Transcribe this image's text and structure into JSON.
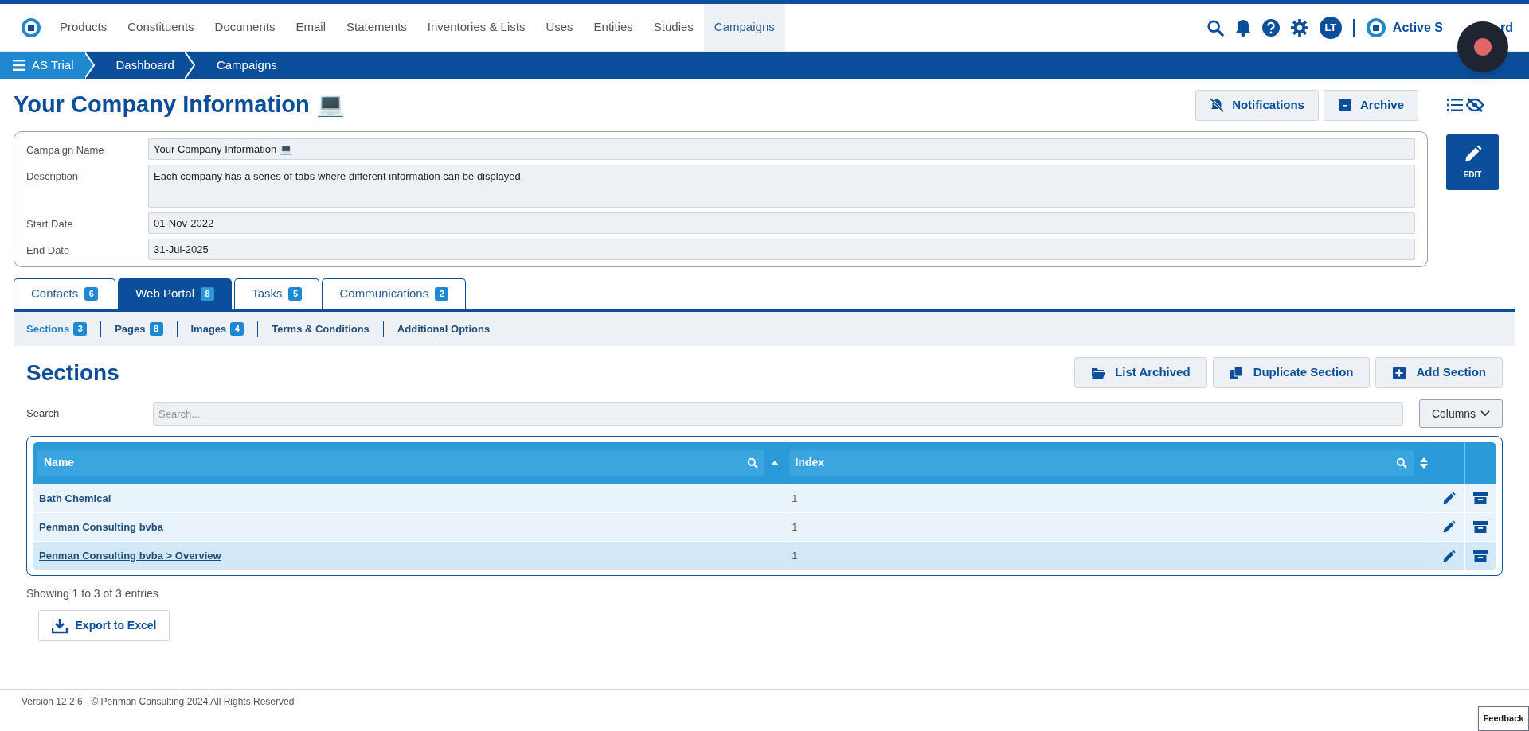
{
  "nav": {
    "items": [
      {
        "label": "Products",
        "selected": false
      },
      {
        "label": "Constituents",
        "selected": false
      },
      {
        "label": "Documents",
        "selected": false
      },
      {
        "label": "Email",
        "selected": false
      },
      {
        "label": "Statements",
        "selected": false
      },
      {
        "label": "Inventories & Lists",
        "selected": false
      },
      {
        "label": "Uses",
        "selected": false
      },
      {
        "label": "Entities",
        "selected": false
      },
      {
        "label": "Studies",
        "selected": false
      },
      {
        "label": "Campaigns",
        "selected": true
      }
    ],
    "user_initials": "LT",
    "brand_start": "Active S",
    "brand_end": "rd"
  },
  "breadcrumb": [
    "AS Trial",
    "Dashboard",
    "Campaigns"
  ],
  "page_title": "Your Company Information 💻",
  "header_buttons": [
    {
      "label": "Notifications",
      "kind": "bell-off"
    },
    {
      "label": "Archive",
      "kind": "archive"
    }
  ],
  "campaign_form": {
    "fields": [
      {
        "label": "Campaign Name",
        "value": "Your Company Information 💻",
        "kind": "input"
      },
      {
        "label": "Description",
        "value": "Each company has a series of tabs where different information can be displayed.",
        "kind": "textarea"
      },
      {
        "label": "Start Date",
        "value": "01-Nov-2022",
        "kind": "input"
      },
      {
        "label": "End Date",
        "value": "31-Jul-2025",
        "kind": "input"
      }
    ]
  },
  "edit_button": "EDIT",
  "tabs": [
    {
      "label": "Contacts",
      "count": "6",
      "selected": false
    },
    {
      "label": "Web Portal",
      "count": "8",
      "selected": true
    },
    {
      "label": "Tasks",
      "count": "5",
      "selected": false
    },
    {
      "label": "Communications",
      "count": "2",
      "selected": false
    }
  ],
  "subtabs": [
    {
      "label": "Sections",
      "count": "3",
      "selected": true
    },
    {
      "label": "Pages",
      "count": "8",
      "selected": false
    },
    {
      "label": "Images",
      "count": "4",
      "selected": false
    },
    {
      "label": "Terms & Conditions",
      "selected": false
    },
    {
      "label": "Additional Options",
      "selected": false
    }
  ],
  "section_title": "Sections",
  "section_buttons": [
    {
      "label": "List Archived",
      "kind": "folder"
    },
    {
      "label": "Duplicate Section",
      "kind": "copy"
    },
    {
      "label": "Add Section",
      "kind": "plus"
    }
  ],
  "search": {
    "label": "Search",
    "placeholder": "Search..."
  },
  "columns_button": "Columns",
  "table": {
    "columns": [
      {
        "label": "Name",
        "sorted": true
      },
      {
        "label": "Index",
        "sorted": false
      }
    ],
    "rows": [
      {
        "name": "Bath Chemical",
        "index": "1",
        "selected": false
      },
      {
        "name": "Penman Consulting bvba",
        "index": "1",
        "selected": false
      },
      {
        "name": "Penman Consulting bvba > Overview",
        "index": "1",
        "selected": true
      }
    ]
  },
  "entries_info": "Showing 1 to 3 of 3 entries",
  "export_button": "Export to Excel",
  "footer": "Version 12.2.6 - © Penman Consulting 2024 All Rights Reserved",
  "feedback": "Feedback"
}
